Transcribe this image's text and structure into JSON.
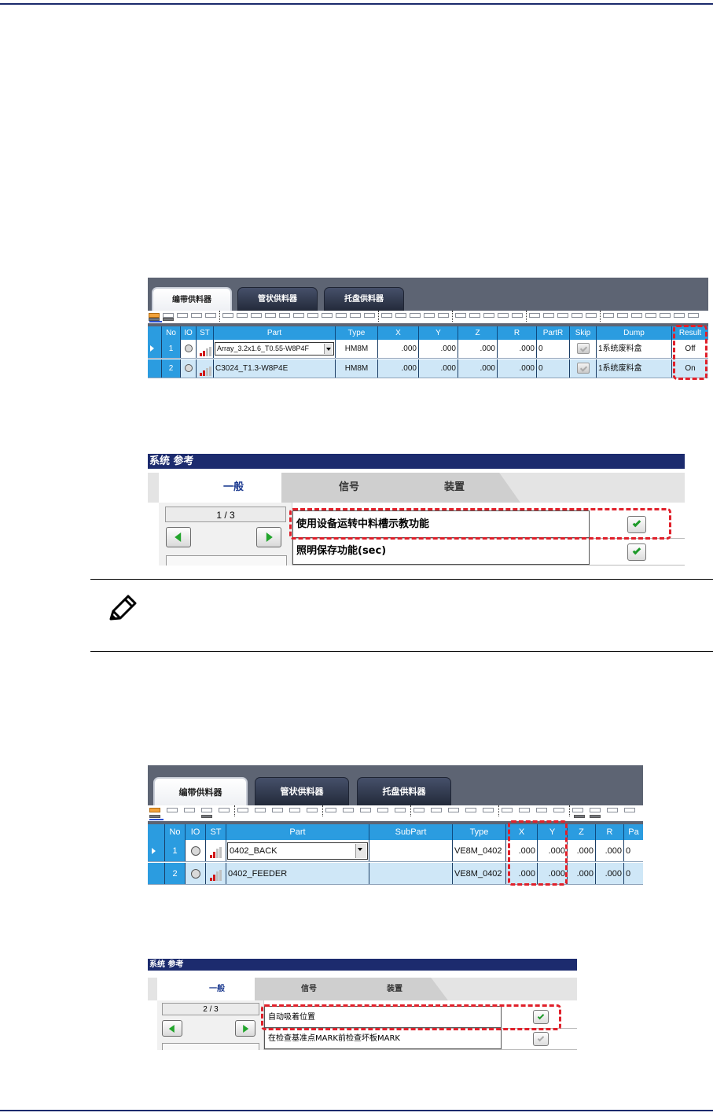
{
  "feeder_panel_1": {
    "tabs": [
      "编带供料器",
      "管状供料器",
      "托盘供料器"
    ],
    "columns": [
      "No",
      "IO",
      "ST",
      "Part",
      "Type",
      "X",
      "Y",
      "Z",
      "R",
      "PartR",
      "Skip",
      "Dump",
      "Result"
    ],
    "rows": [
      {
        "no": "1",
        "part": "Array_3.2x1.6_T0.55-W8P4F",
        "type": "HM8M",
        "x": ".000",
        "y": ".000",
        "z": ".000",
        "r": ".000",
        "partr": "0",
        "dump": "1系统废料盒",
        "result": "Off"
      },
      {
        "no": "2",
        "part": "C3024_T1.3-W8P4E",
        "type": "HM8M",
        "x": ".000",
        "y": ".000",
        "z": ".000",
        "r": ".000",
        "partr": "0",
        "dump": "1系统废料盒",
        "result": "On"
      }
    ]
  },
  "system_panel_1": {
    "title": "系统 参考",
    "tabs": [
      "一般",
      "信号",
      "装置"
    ],
    "page": "1 / 3",
    "options": [
      {
        "label": "使用设备运转中料槽示教功能",
        "checked": true
      },
      {
        "label": "照明保存功能(sec)",
        "checked": true
      }
    ]
  },
  "feeder_panel_2": {
    "tabs": [
      "编带供料器",
      "管状供料器",
      "托盘供料器"
    ],
    "columns": [
      "No",
      "IO",
      "ST",
      "Part",
      "SubPart",
      "Type",
      "X",
      "Y",
      "Z",
      "R",
      "Pa"
    ],
    "rows": [
      {
        "no": "1",
        "part": "0402_BACK",
        "subpart": "",
        "type": "VE8M_0402",
        "x": ".000",
        "y": ".000",
        "z": ".000",
        "r": ".000",
        "pa": "0"
      },
      {
        "no": "2",
        "part": "0402_FEEDER",
        "subpart": "",
        "type": "VE8M_0402",
        "x": ".000",
        "y": ".000",
        "z": ".000",
        "r": ".000",
        "pa": "0"
      }
    ]
  },
  "system_panel_2": {
    "title": "系统 参考",
    "tabs": [
      "一般",
      "信号",
      "装置"
    ],
    "page": "2 / 3",
    "options": [
      {
        "label": "自动吸着位置",
        "checked": true
      },
      {
        "label": "在检查基准点MARK前检查坏板MARK",
        "checked": true,
        "disabled": true
      }
    ]
  },
  "colors": {
    "header_blue": "#2b9ce0",
    "highlight_red": "#e0202a",
    "title_navy": "#1c2b6e",
    "check_green": "#1e9a2a"
  },
  "icons": [
    "pencil-note-icon",
    "row-pointer-icon",
    "io-indicator-icon",
    "signal-bars-icon",
    "chevron-left-icon",
    "chevron-right-icon",
    "checkmark-icon"
  ]
}
